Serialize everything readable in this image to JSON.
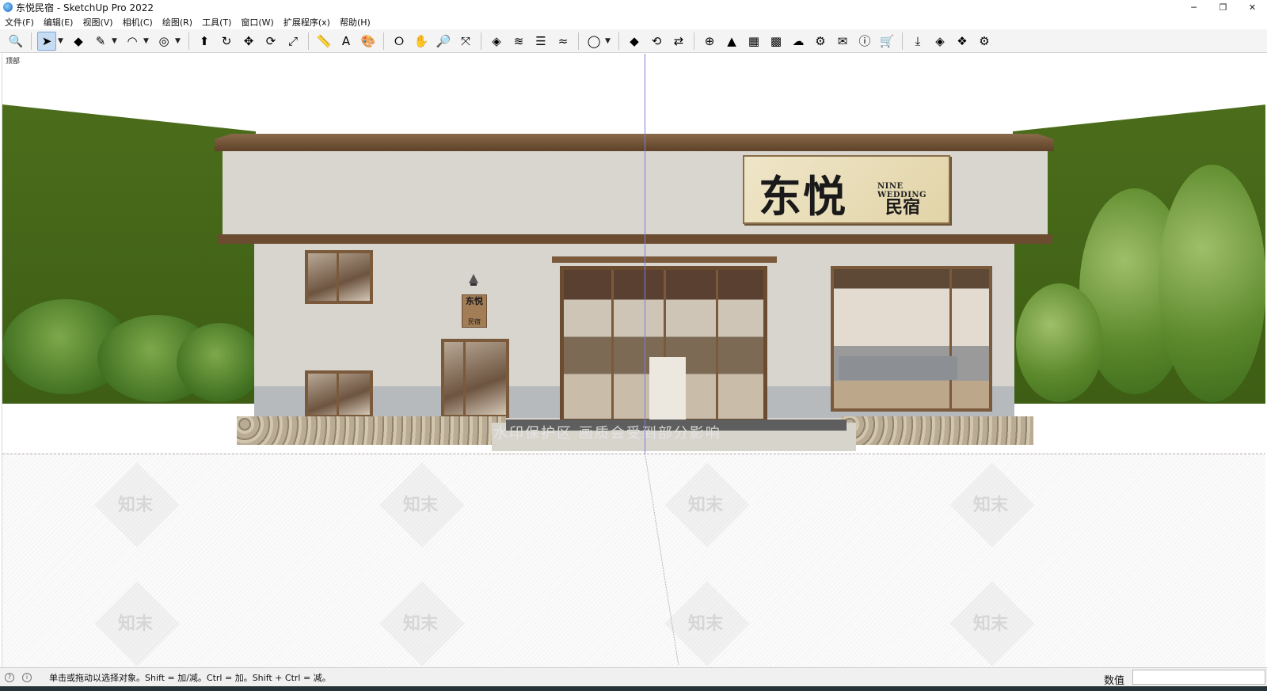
{
  "window": {
    "title": "东悦民宿 - SketchUp Pro 2022",
    "controls": {
      "minimize": "─",
      "restore": "❐",
      "close": "✕"
    }
  },
  "menubar": {
    "items": [
      "文件(F)",
      "编辑(E)",
      "视图(V)",
      "相机(C)",
      "绘图(R)",
      "工具(T)",
      "窗口(W)",
      "扩展程序(x)",
      "帮助(H)"
    ]
  },
  "toolbar": {
    "buttons": [
      {
        "name": "zoom-window-icon",
        "glyph": "🔍"
      },
      {
        "name": "select-icon",
        "glyph": "➤",
        "active": true
      },
      {
        "name": "eraser-icon",
        "glyph": "◆"
      },
      {
        "name": "pencil-icon",
        "glyph": "✎"
      },
      {
        "name": "arc-icon",
        "glyph": "◠"
      },
      {
        "name": "offset-icon",
        "glyph": "◎"
      },
      {
        "name": "push-pull-icon",
        "glyph": "⬆"
      },
      {
        "name": "follow-me-icon",
        "glyph": "↻"
      },
      {
        "name": "move-icon",
        "glyph": "✥"
      },
      {
        "name": "rotate-icon",
        "glyph": "⟳"
      },
      {
        "name": "scale-icon",
        "glyph": "⤢"
      },
      {
        "name": "tape-measure-icon",
        "glyph": "📏"
      },
      {
        "name": "text-icon",
        "glyph": "A"
      },
      {
        "name": "paint-bucket-icon",
        "glyph": "🎨"
      },
      {
        "name": "orbit-icon",
        "glyph": "⭘"
      },
      {
        "name": "pan-icon",
        "glyph": "✋"
      },
      {
        "name": "zoom-icon",
        "glyph": "🔎"
      },
      {
        "name": "zoom-extents-icon",
        "glyph": "⤧"
      },
      {
        "name": "warehouse-icon",
        "glyph": "◈"
      },
      {
        "name": "extension-icon",
        "glyph": "≋"
      },
      {
        "name": "layers-icon",
        "glyph": "☰"
      },
      {
        "name": "sandbox-icon",
        "glyph": "≈"
      },
      {
        "name": "account-icon",
        "glyph": "◯"
      },
      {
        "name": "plugin-a-icon",
        "glyph": "◆"
      },
      {
        "name": "refresh-icon",
        "glyph": "⟲"
      },
      {
        "name": "transfer-icon",
        "glyph": "⇄"
      },
      {
        "name": "add-icon",
        "glyph": "⊕"
      },
      {
        "name": "tree-icon",
        "glyph": "▲"
      },
      {
        "name": "chart-icon",
        "glyph": "▦"
      },
      {
        "name": "checker-icon",
        "glyph": "▩"
      },
      {
        "name": "cloud-upload-icon",
        "glyph": "☁"
      },
      {
        "name": "settings-icon",
        "glyph": "⚙"
      },
      {
        "name": "mail-icon",
        "glyph": "✉"
      },
      {
        "name": "info-icon",
        "glyph": "ⓘ"
      },
      {
        "name": "cart-icon",
        "glyph": "🛒"
      },
      {
        "name": "download-icon",
        "glyph": "⤓"
      },
      {
        "name": "plugin-b-icon",
        "glyph": "◈"
      },
      {
        "name": "plugin-c-icon",
        "glyph": "❖"
      },
      {
        "name": "gear-icon",
        "glyph": "⚙"
      }
    ]
  },
  "viewport": {
    "scene_label": "顶部",
    "watermark_banner": "水印保护区   画质会受到部分影响",
    "watermark_text": "知末"
  },
  "model": {
    "sign_main": "东悦",
    "sign_english": "NINE WEDDING",
    "sign_sub": "民宿",
    "small_sign_main": "东悦",
    "small_sign_sub": "民宿"
  },
  "statusbar": {
    "hint": "单击或拖动以选择对象。Shift = 加/减。Ctrl = 加。Shift + Ctrl = 减。",
    "measurements_label": "数值",
    "measurements_value": ""
  },
  "colors": {
    "hill_green": "#3d5e14",
    "roof_brown": "#6b4c30",
    "wall": "#d8d5cf",
    "signboard": "#e8dcb8",
    "axis_blue": "#7d7ddb"
  }
}
